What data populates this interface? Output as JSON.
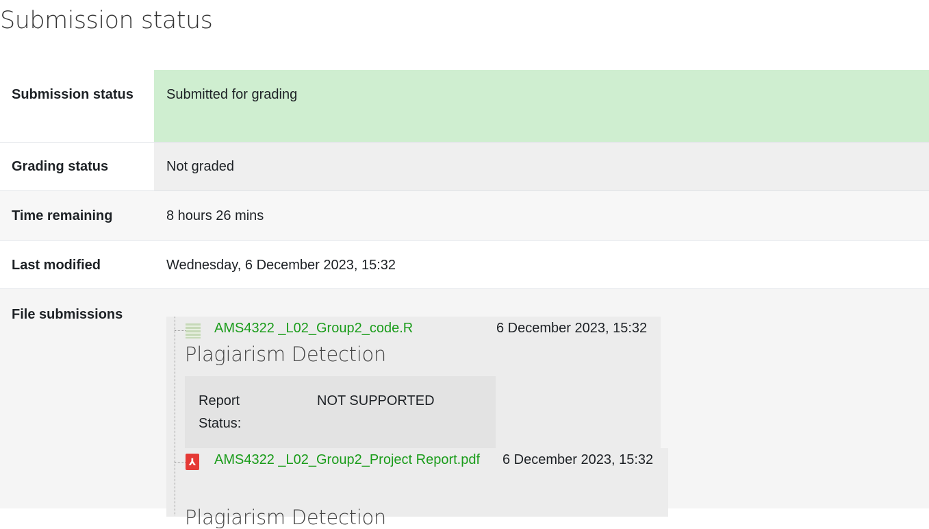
{
  "page_title": "Submission status",
  "rows": [
    {
      "label": "Submission status",
      "value": "Submitted for grading",
      "status_color": "#cfeed0"
    },
    {
      "label": "Grading status",
      "value": "Not graded"
    },
    {
      "label": "Time remaining",
      "value": "8 hours 26 mins"
    },
    {
      "label": "Last modified",
      "value": "Wednesday, 6 December 2023, 15:32"
    },
    {
      "label": "File submissions"
    }
  ],
  "files": [
    {
      "name": "AMS4322 _L02_Group2_code.R",
      "date": "6 December 2023, 15:32",
      "icon": "text-file-icon",
      "plagiarism_heading": "Plagiarism Detection",
      "report_status_label": "Report Status:",
      "report_status_value": "NOT SUPPORTED"
    },
    {
      "name": "AMS4322 _L02_Group2_Project Report.pdf",
      "date": "6 December 2023, 15:32",
      "icon": "pdf-file-icon",
      "plagiarism_heading": "Plagiarism Detection"
    }
  ],
  "colors": {
    "link": "#1a9c1a",
    "submitted_bg": "#cfeed0"
  }
}
